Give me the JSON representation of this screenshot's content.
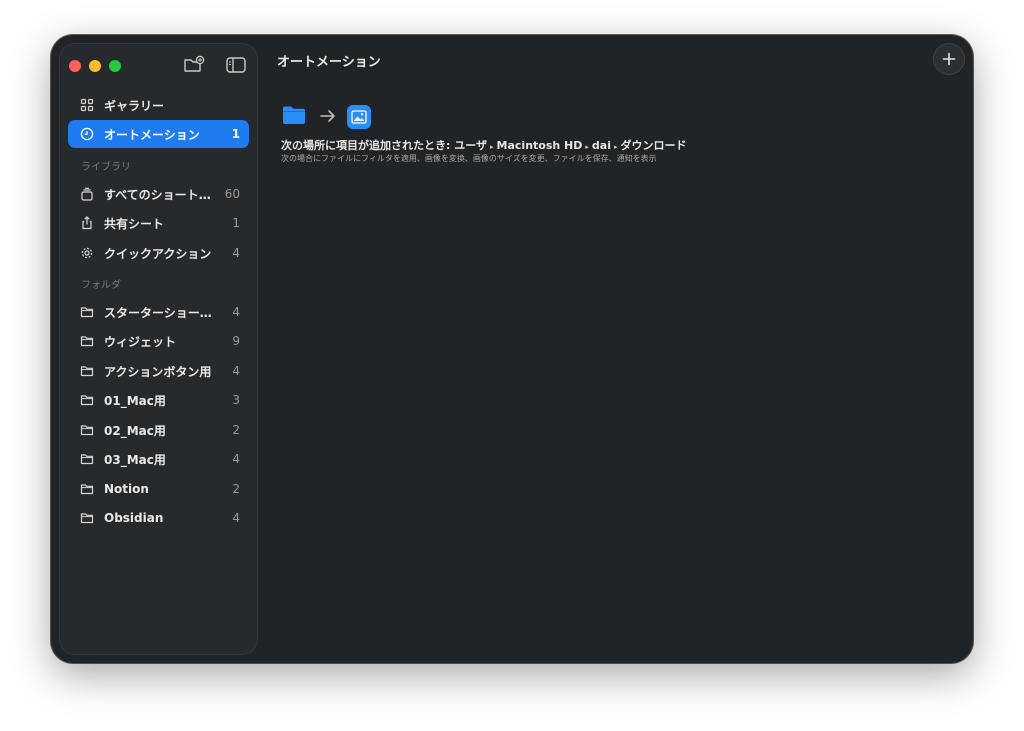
{
  "window": {
    "title": "オートメーション"
  },
  "sidebar": {
    "top_items": [
      {
        "label": "ギャラリー",
        "icon": "gallery-grid-icon",
        "count": ""
      },
      {
        "label": "オートメーション",
        "icon": "clock-icon",
        "count": "1",
        "selected": true
      }
    ],
    "library_label": "ライブラリ",
    "library_items": [
      {
        "label": "すべてのショートカット",
        "icon": "stack-icon",
        "count": "60"
      },
      {
        "label": "共有シート",
        "icon": "share-icon",
        "count": "1"
      },
      {
        "label": "クイックアクション",
        "icon": "gear-icon",
        "count": "4"
      }
    ],
    "folders_label": "フォルダ",
    "folder_items": [
      {
        "label": "スターターショートカット",
        "icon": "folder-icon",
        "count": "4"
      },
      {
        "label": "ウィジェット",
        "icon": "folder-icon",
        "count": "9"
      },
      {
        "label": "アクションボタン用",
        "icon": "folder-icon",
        "count": "4"
      },
      {
        "label": "01_Mac用",
        "icon": "folder-icon",
        "count": "3"
      },
      {
        "label": "02_Mac用",
        "icon": "folder-icon",
        "count": "2"
      },
      {
        "label": "03_Mac用",
        "icon": "folder-icon",
        "count": "4"
      },
      {
        "label": "Notion",
        "icon": "folder-icon",
        "count": "2"
      },
      {
        "label": "Obsidian",
        "icon": "folder-icon",
        "count": "4"
      }
    ]
  },
  "automation": {
    "trigger_icon": "folder-icon",
    "action_icon": "image-icon",
    "title_prefix": "次の場所に項目が追加されたとき: ",
    "path": [
      "ユーザ",
      "Macintosh HD",
      "dai",
      "ダウンロード"
    ],
    "path_separator": "▸",
    "subtitle": "次の場合にファイルにフィルタを適用、画像を変換、画像のサイズを変更、ファイルを保存、通知を表示"
  },
  "colors": {
    "accent": "#1e7cf0",
    "window_bg": "#212426",
    "sidebar_bg": "#272a2d",
    "folder_blue": "#2a8ef8"
  }
}
